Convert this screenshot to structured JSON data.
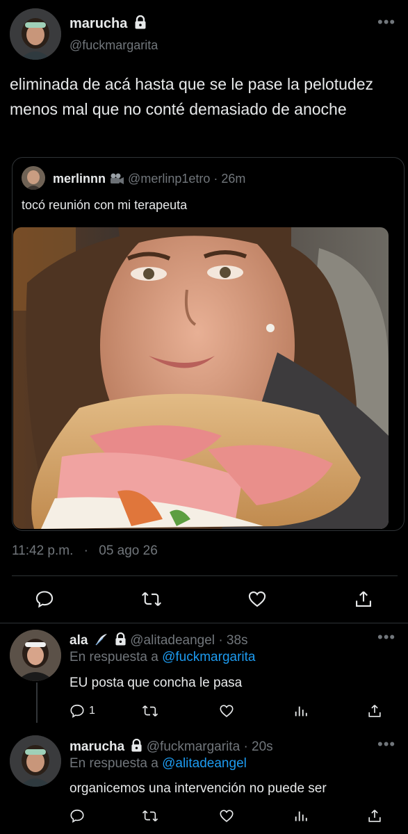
{
  "main_tweet": {
    "display_name": "marucha",
    "handle": "@fuckmargarita",
    "text": "eliminada de acá hasta que se le pase la pelotudez menos mal que no conté demasiado de anoche",
    "time": "11:42 p.m.",
    "separator": "·",
    "date": "05 ago 26"
  },
  "quoted_tweet": {
    "display_name": "merlinnn",
    "handle": "@merlinp1etro",
    "time": "· 26m",
    "text": "tocó reunión con mi terapeuta",
    "media_icon": "film-camera-icon"
  },
  "replies": [
    {
      "display_name": "ala",
      "badge_icon": "feather-icon",
      "handle": "@alitadeangel",
      "time": "· 38s",
      "in_reply_prefix": "En respuesta a ",
      "in_reply_handle": "@fuckmargarita",
      "text": "EU posta que concha le pasa",
      "reply_count": "1"
    },
    {
      "display_name": "marucha",
      "handle": "@fuckmargarita",
      "time": "· 20s",
      "in_reply_prefix": "En respuesta a ",
      "in_reply_handle": "@alitadeangel",
      "text": "organicemos una intervención no puede ser",
      "reply_count": ""
    }
  ],
  "colors": {
    "background": "#000000",
    "text": "#e7e9ea",
    "muted": "#71767b",
    "link": "#1d9bf0",
    "divider": "#2f3336"
  }
}
